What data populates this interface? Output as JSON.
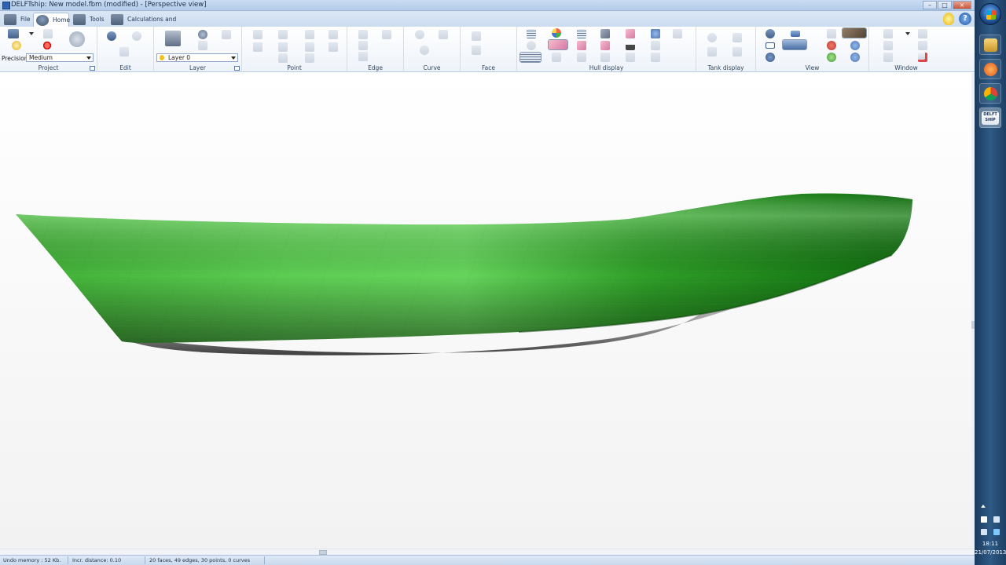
{
  "window": {
    "title": "DELFTship: New model.fbm (modified) - [Perspective view]",
    "controls": [
      "–",
      "□",
      "×"
    ]
  },
  "ribbon_tabs": [
    {
      "label": "File",
      "active": false
    },
    {
      "label": "Home",
      "active": true
    },
    {
      "label": "Tools",
      "active": false
    },
    {
      "label": "Calculations and extensions",
      "active": false
    }
  ],
  "help": {
    "tip_icon": "lightbulb-icon",
    "help_icon": "help-icon",
    "help_glyph": "?"
  },
  "groups": {
    "project": {
      "label": "Project",
      "precision_label": "Precision",
      "precision_value": "Medium"
    },
    "edit": {
      "label": "Edit"
    },
    "layer": {
      "label": "Layer",
      "layer_value": "Layer 0"
    },
    "point": {
      "label": "Point"
    },
    "edge": {
      "label": "Edge"
    },
    "curve": {
      "label": "Curve"
    },
    "face": {
      "label": "Face"
    },
    "hull_display": {
      "label": "Hull display"
    },
    "tank_display": {
      "label": "Tank display"
    },
    "view": {
      "label": "View"
    },
    "window": {
      "label": "Window"
    }
  },
  "viewport": {
    "name": "Perspective view",
    "hull_color": "#2a9a22",
    "hull_highlight": "#86df7a",
    "underside_color": "#9a9a9a"
  },
  "status": {
    "undo_memory": "Undo memory : 52 Kb.",
    "incr_distance": "Incr. distance: 0.10",
    "model_stats": "20 faces, 49 edges, 30 points, 0 curves"
  },
  "taskbar": {
    "time": "18:11",
    "date": "21/07/2013",
    "apps": [
      "explorer",
      "media-player",
      "chrome",
      "delftship"
    ],
    "delftship_badge": "DELFT SHIP"
  }
}
